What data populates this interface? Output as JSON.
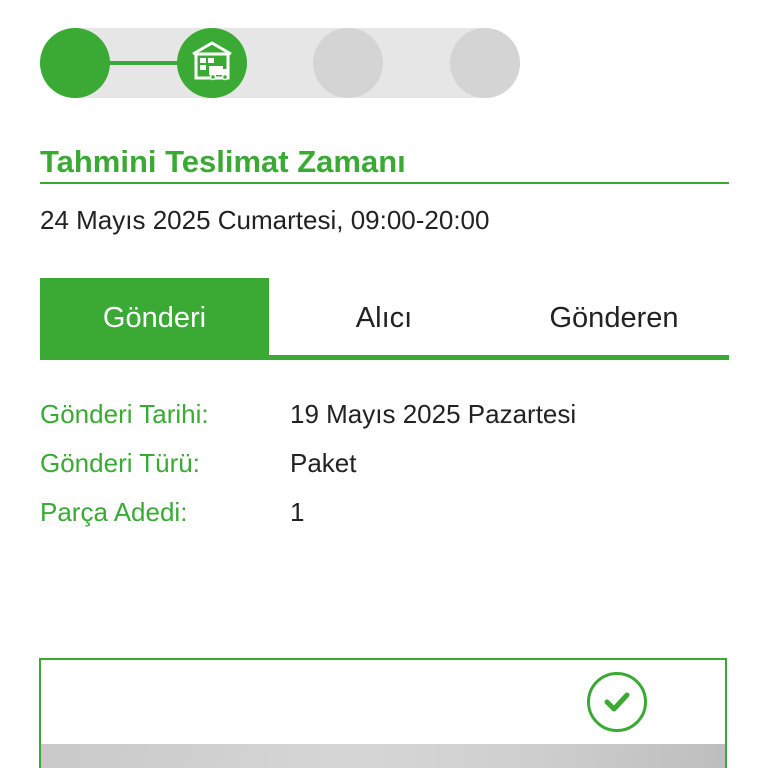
{
  "progress": {
    "steps": [
      {
        "state": "completed",
        "icon": "filled-circle"
      },
      {
        "state": "current",
        "icon": "warehouse-truck-icon"
      },
      {
        "state": "pending",
        "icon": "empty-circle"
      },
      {
        "state": "pending",
        "icon": "empty-circle"
      }
    ],
    "colors": {
      "active": "#3aaa35",
      "inactive": "#d4d4d4",
      "track": "#e6e6e6"
    }
  },
  "estimated_delivery": {
    "title": "Tahmini Teslimat Zamanı",
    "value": "24 Mayıs 2025 Cumartesi, 09:00-20:00"
  },
  "tabs": [
    {
      "label": "Gönderi",
      "active": true
    },
    {
      "label": "Alıcı",
      "active": false
    },
    {
      "label": "Gönderen",
      "active": false
    }
  ],
  "details": [
    {
      "label": "Gönderi Tarihi:",
      "value": "19 Mayıs 2025 Pazartesi"
    },
    {
      "label": "Gönderi Türü:",
      "value": "Paket"
    },
    {
      "label": "Parça Adedi:",
      "value": "1"
    }
  ],
  "card": {
    "status_icon": "check-circle-icon"
  },
  "theme": {
    "accent": "#3aaa35",
    "text": "#222222",
    "background": "#ffffff"
  }
}
